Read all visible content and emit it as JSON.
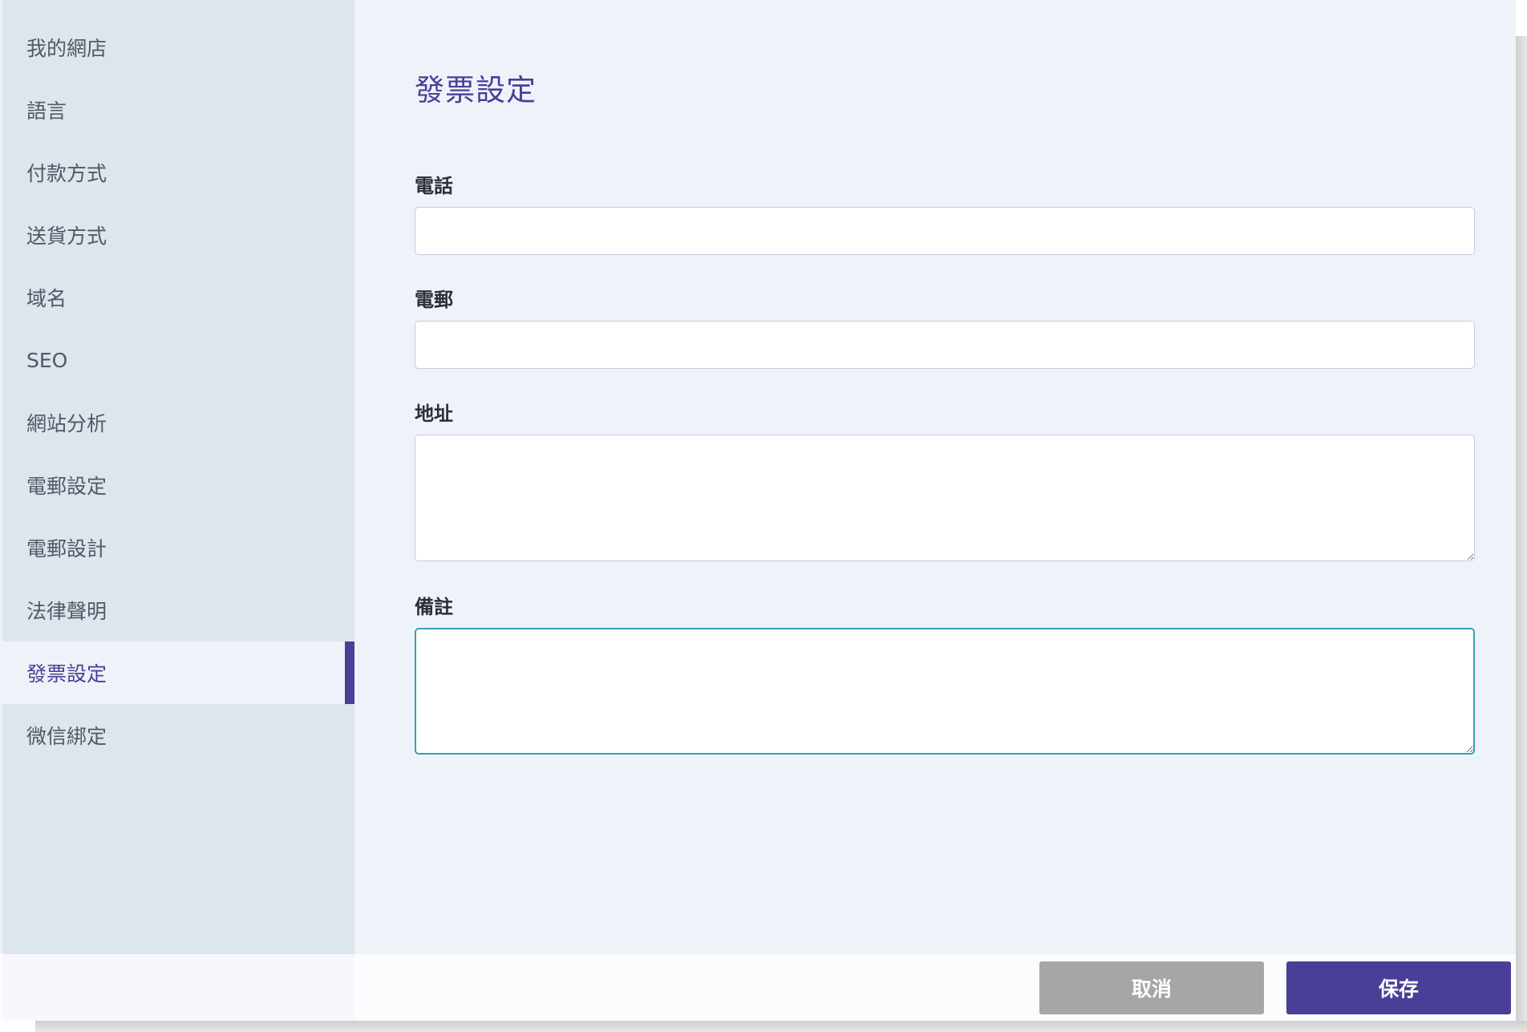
{
  "sidebar": {
    "items": [
      {
        "label": "我的網店",
        "active": false
      },
      {
        "label": "語言",
        "active": false
      },
      {
        "label": "付款方式",
        "active": false
      },
      {
        "label": "送貨方式",
        "active": false
      },
      {
        "label": "域名",
        "active": false
      },
      {
        "label": "SEO",
        "active": false
      },
      {
        "label": "網站分析",
        "active": false
      },
      {
        "label": "電郵設定",
        "active": false
      },
      {
        "label": "電郵設計",
        "active": false
      },
      {
        "label": "法律聲明",
        "active": false
      },
      {
        "label": "發票設定",
        "active": true
      },
      {
        "label": "微信綁定",
        "active": false
      }
    ]
  },
  "main": {
    "title": "發票設定",
    "fields": {
      "phone": {
        "label": "電話",
        "value": ""
      },
      "email": {
        "label": "電郵",
        "value": ""
      },
      "address": {
        "label": "地址",
        "value": ""
      },
      "notes": {
        "label": "備註",
        "value": ""
      }
    }
  },
  "footer": {
    "cancel_label": "取消",
    "save_label": "保存"
  },
  "colors": {
    "accent": "#4a3f96",
    "focus_border": "#3a9fb7",
    "cancel_button": "#a6a6a6"
  }
}
